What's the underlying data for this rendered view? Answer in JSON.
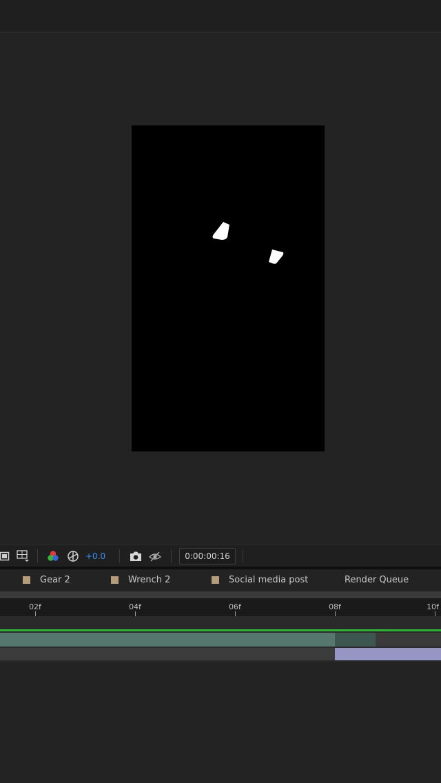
{
  "viewer_toolbar": {
    "exposure_value": "+0.0",
    "timecode": "0:00:00:16",
    "icons": [
      "region-of-interest-icon",
      "grid-guides-icon",
      "color-channels-icon",
      "reset-exposure-icon",
      "snapshot-icon",
      "show-snapshot-icon"
    ]
  },
  "tabs": [
    {
      "label": "Gear 2",
      "swatch": "#b59d7c"
    },
    {
      "label": "Wrench 2",
      "swatch": "#b59d7c"
    },
    {
      "label": "Social media post",
      "swatch": "#b59d7c"
    },
    {
      "label": "Render Queue"
    }
  ],
  "ruler": {
    "ticks": [
      "02f",
      "04f",
      "06f",
      "08f",
      "10f"
    ]
  },
  "colors": {
    "accent_blue": "#3c8df2",
    "timeline_green": "#2fb235",
    "layer_teal": "#56776d",
    "layer_lilac": "#9695c3",
    "label_swatch": "#b59d7c"
  }
}
